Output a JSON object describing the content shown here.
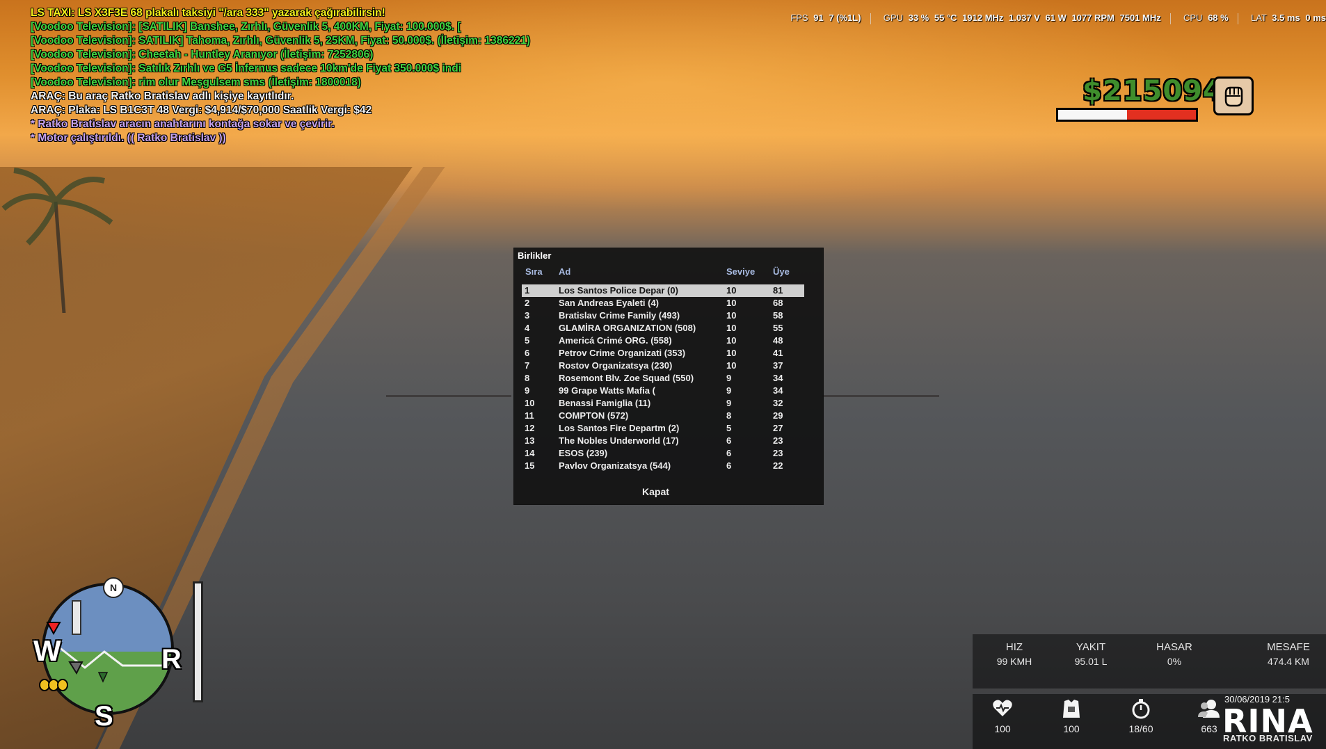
{
  "chat": [
    {
      "color": "yellow",
      "text": "LS TAXI: LS X3F3E 68 plakalı taksiyi \"/ara 333\" yazarak çağırabilirsin!"
    },
    {
      "color": "green",
      "text": "[Voodoo Television]: [SATILIK] Banshee, Zırhlı, Güvenlik 5, 400KM, Fiyat: 100.000$. ["
    },
    {
      "color": "green",
      "text": "[Voodoo Television]: SATILIK] Tahoma, Zırhlı, Güvenlik 5, 25KM, Fiyat: 50.000$. (İletişim: 1386221)"
    },
    {
      "color": "green",
      "text": "[Voodoo Television]: Cheetah - Huntley Aranıyor (İletişim: 7252806)"
    },
    {
      "color": "green",
      "text": "[Voodoo Television]: Satılık Zırhlı ve G5 İnfernus sadece 10km'de Fiyat 350.000$ indi"
    },
    {
      "color": "green",
      "text": "[Voodoo Television]: rim olur Meşgulsem sms (İletişim: 1800018)"
    },
    {
      "color": "white",
      "text": "ARAÇ: Bu araç Ratko Bratislav adlı kişiye kayıtlıdır."
    },
    {
      "color": "white",
      "text": "ARAÇ: Plaka: LS B1C3T 48 Vergi: $4,914/$70,000 Saatlik Vergi: $42"
    },
    {
      "color": "purple",
      "text": "* Ratko Bratislav aracın anahtarını kontağa sokar ve çevirir."
    },
    {
      "color": "purple",
      "text": "* Motor çalıştırıldı. (( Ratko Bratislav ))"
    }
  ],
  "perf": {
    "fps_label": "FPS",
    "fps": "91",
    "fps_low": "7 (%1L)",
    "gpu_label": "GPU",
    "gpu_usage": "33 %",
    "gpu_temp": "55 °C",
    "gpu_clock": "1912 MHz",
    "gpu_volt": "1.037 V",
    "gpu_power": "61 W",
    "gpu_fan": "1077 RPM",
    "gpu_mem": "7501 MHz",
    "cpu_label": "CPU",
    "cpu_usage": "68 %",
    "lat_label": "LAT",
    "lat_1": "3.5 ms",
    "lat_2": "0 ms"
  },
  "hud": {
    "money": "$215094",
    "health_white": 0.5,
    "health_red": 0.5,
    "weapon_icon": "fist-icon"
  },
  "dialog": {
    "title": "Birlikler",
    "headers": {
      "rank": "Sıra",
      "name": "Ad",
      "level": "Seviye",
      "members": "Üye"
    },
    "rows": [
      {
        "rank": "1",
        "name": "Los Santos Police Depar (0)",
        "level": "10",
        "members": "81"
      },
      {
        "rank": "2",
        "name": "San Andreas Eyaleti (4)",
        "level": "10",
        "members": "68"
      },
      {
        "rank": "3",
        "name": "Bratislav Crime Family (493)",
        "level": "10",
        "members": "58"
      },
      {
        "rank": "4",
        "name": "GLAMİRA ORGANIZATION (508)",
        "level": "10",
        "members": "55"
      },
      {
        "rank": "5",
        "name": "Americá Crimé ORG. (558)",
        "level": "10",
        "members": "48"
      },
      {
        "rank": "6",
        "name": "Petrov Crime Organizati (353)",
        "level": "10",
        "members": "41"
      },
      {
        "rank": "7",
        "name": "Rostov Organizatsya (230)",
        "level": "10",
        "members": "37"
      },
      {
        "rank": "8",
        "name": "Rosemont Blv. Zoe Squad (550)",
        "level": "9",
        "members": "34"
      },
      {
        "rank": "9",
        "name": "99 Grape Watts Mafia (",
        "level": "9",
        "members": "34"
      },
      {
        "rank": "10",
        "name": "Benassi Famiglia (11)",
        "level": "9",
        "members": "32"
      },
      {
        "rank": "11",
        "name": "COMPTON (572)",
        "level": "8",
        "members": "29"
      },
      {
        "rank": "12",
        "name": "Los Santos Fire Departm (2)",
        "level": "5",
        "members": "27"
      },
      {
        "rank": "13",
        "name": "The Nobles Underworld (17)",
        "level": "6",
        "members": "23"
      },
      {
        "rank": "14",
        "name": "ESOS (239)",
        "level": "6",
        "members": "23"
      },
      {
        "rank": "15",
        "name": "Pavlov Organizatsya (544)",
        "level": "6",
        "members": "22"
      }
    ],
    "selected_row": 1,
    "close_label": "Kapat"
  },
  "minimap": {
    "north": "N",
    "west": "W",
    "south": "S",
    "east": "R"
  },
  "vehicle": {
    "speed_label": "HIZ",
    "speed": "99 KMH",
    "fuel_label": "YAKIT",
    "fuel": "95.01 L",
    "damage_label": "HASAR",
    "damage": "0%",
    "distance_label": "MESAFE",
    "distance": "474.4 KM"
  },
  "status_icons": [
    {
      "icon": "heart-icon",
      "value": "100"
    },
    {
      "icon": "armor-icon",
      "value": "100"
    },
    {
      "icon": "timer-icon",
      "value": "18/60"
    },
    {
      "icon": "players-icon",
      "value": "663"
    }
  ],
  "datetime": "30/06/2019 21:5",
  "logo": "RINA",
  "player_name": "RATKO BRATISLAV"
}
